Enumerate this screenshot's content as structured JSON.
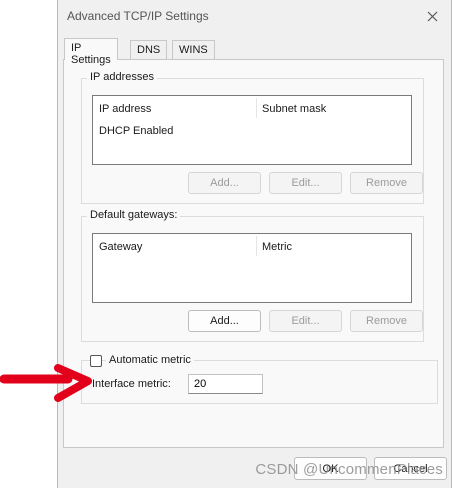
{
  "window": {
    "title": "Advanced TCP/IP Settings"
  },
  "tabs": [
    {
      "label": "IP Settings",
      "active": true
    },
    {
      "label": "DNS",
      "active": false
    },
    {
      "label": "WINS",
      "active": false
    }
  ],
  "ip_addresses": {
    "group_label": "IP addresses",
    "columns": [
      "IP address",
      "Subnet mask"
    ],
    "rows": [
      "DHCP Enabled"
    ],
    "buttons": {
      "add": "Add...",
      "edit": "Edit...",
      "remove": "Remove"
    }
  },
  "gateways": {
    "group_label": "Default gateways:",
    "columns": [
      "Gateway",
      "Metric"
    ],
    "buttons": {
      "add": "Add...",
      "edit": "Edit...",
      "remove": "Remove"
    }
  },
  "metric": {
    "automatic_label": "Automatic metric",
    "automatic_checked": false,
    "interface_label": "Interface metric:",
    "interface_value": "20"
  },
  "footer": {
    "ok": "OK",
    "cancel": "Cancel"
  },
  "watermark": "CSDN @UncommenPlaces",
  "annotation": {
    "arrow_color": "#e3001b",
    "icon": "red-arrow-icon"
  }
}
